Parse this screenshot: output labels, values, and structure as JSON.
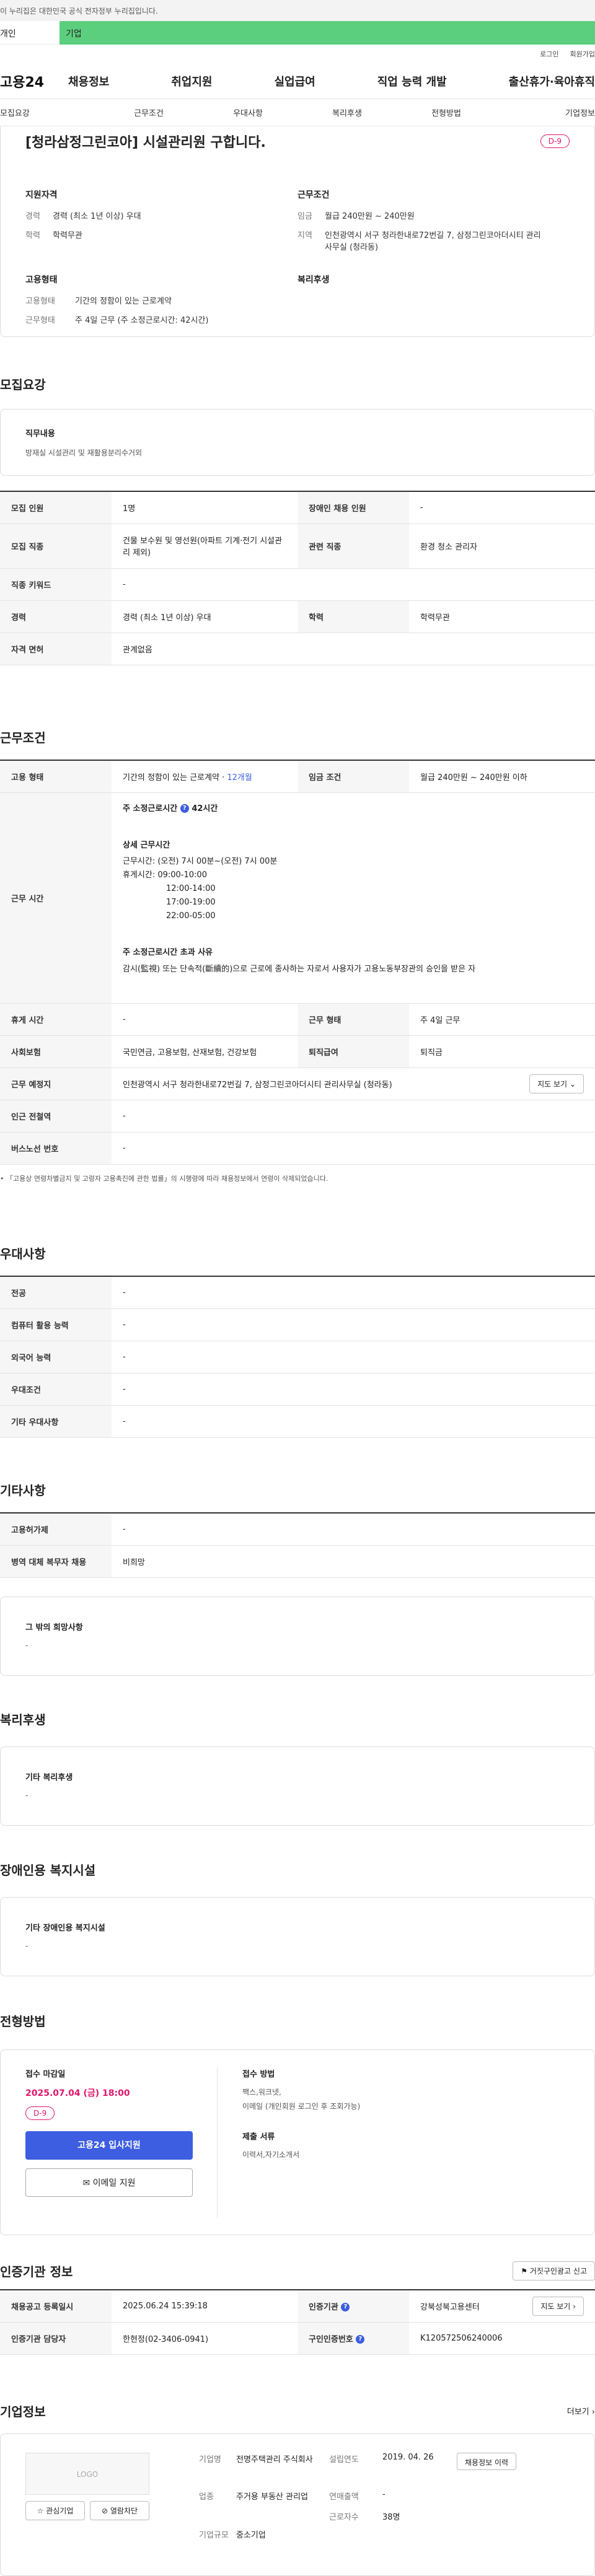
{
  "gov_banner": "이 누리집은 대한민국 공식 전자정부 누리집입니다.",
  "tabs": [
    "개인",
    "기업"
  ],
  "util": [
    "로그인",
    "회원가입"
  ],
  "logo": "고용24",
  "gnb": [
    "채용정보",
    "취업지원",
    "실업급여",
    "직업 능력 개발",
    "출산휴가·육아휴직"
  ],
  "subnav": [
    "모집요강",
    "근무조건",
    "우대사항",
    "복리후생",
    "전형방법",
    "기업정보"
  ],
  "summary": {
    "title": "[청라삼정그린코아] 시설관리원 구합니다.",
    "dday": "D-9",
    "qual_title": "지원자격",
    "qual": [
      {
        "k": "경력",
        "v": "경력 (최소 1년 이상) 우대"
      },
      {
        "k": "학력",
        "v": "학력무관"
      }
    ],
    "cond_title": "근무조건",
    "cond": [
      {
        "k": "임금",
        "v": "월급 240만원 ~ 240만원"
      },
      {
        "k": "지역",
        "v": "인천광역시 서구 청라한내로72번길 7, 삼정그린코아더시티 관리사무실 (청라동)"
      }
    ],
    "emp_title": "고용형태",
    "emp": [
      {
        "k": "고용형태",
        "v": "기간의 정함이 있는 근로계약"
      },
      {
        "k": "근무형태",
        "v": "주 4일 근무 (주 소정근로시간: 42시간)"
      }
    ],
    "welfare_title": "복리후생"
  },
  "recruit": {
    "title": "모집요강",
    "duty_label": "직무내용",
    "duty_text": "방재실 시설관리 및 재활용분리수거외",
    "rows": [
      {
        "k1": "모집 인원",
        "v1": "1명",
        "k2": "장애인 채용 인원",
        "v2": "-"
      },
      {
        "k1": "모집 직종",
        "v1": "건물 보수원 및 영선원(아파트 기계·전기 시설관리 제외)",
        "k2": "관련 직종",
        "v2": "환경 청소 관리자"
      },
      {
        "k1": "직종 키워드",
        "v1": "-",
        "k2": "",
        "v2": ""
      },
      {
        "k1": "경력",
        "v1": "경력 (최소 1년 이상) 우대",
        "k2": "학력",
        "v2": "학력무관"
      },
      {
        "k1": "자격 면허",
        "v1": "관계없음",
        "k2": "",
        "v2": ""
      }
    ]
  },
  "work": {
    "title": "근무조건",
    "emp_label": "고용 형태",
    "emp_value": "기간의 정함이 있는 근로계약 ·",
    "emp_link": "12개월",
    "wage_label": "임금 조건",
    "wage_value": "월급 240만원 ~ 240만원 이하",
    "time_label": "근무 시간",
    "weekly_label": "주 소정근로시간",
    "weekly_value": "42시간",
    "detail_title": "상세 근무시간",
    "detail_lines": [
      "근무시간: (오전) 7시 00분~(오전) 7시 00분",
      "휴게시간: 09:00-10:00",
      "12:00-14:00",
      "17:00-19:00",
      "22:00-05:00"
    ],
    "over_title": "주 소정근로시간 초과 사유",
    "over_text": "감시(監視) 또는 단속적(斷續的)으로 근로에 종사하는 자로서 사용자가 고용노동부장관의 승인을 받은 자",
    "break_label": "휴게 시간",
    "break_value": "-",
    "form_label": "근무 형태",
    "form_value": "주 4일 근무",
    "ins_label": "사회보험",
    "ins_value": "국민연금, 고용보험, 산재보험, 건강보험",
    "sev_label": "퇴직급여",
    "sev_value": "퇴직금",
    "place_label": "근무 예정지",
    "place_value": "인천광역시 서구 청라한내로72번길 7, 삼정그린코아더시티 관리사무실 (청라동)",
    "map_btn": "지도 보기",
    "subway_label": "인근 전철역",
    "subway_value": "-",
    "bus_label": "버스노선 번호",
    "bus_value": "-",
    "notice": "「고용상 연령차별금지 및 고령자 고용촉진에 관한 법률」의 시행령에 따라 채용정보에서 연령이 삭제되었습니다."
  },
  "pref": {
    "title": "우대사항",
    "rows": [
      {
        "k": "전공",
        "v": "-"
      },
      {
        "k": "컴퓨터 활용 능력",
        "v": "-"
      },
      {
        "k": "외국어 능력",
        "v": "-"
      },
      {
        "k": "우대조건",
        "v": "-"
      },
      {
        "k": "기타 우대사항",
        "v": "-"
      }
    ]
  },
  "etc": {
    "title": "기타사항",
    "rows": [
      {
        "k": "고용허가제",
        "v": "-"
      },
      {
        "k": "병역 대체 복무자 채용",
        "v": "비희망"
      }
    ],
    "other_label": "그 밖의 희망사항",
    "other_value": "-"
  },
  "welfare": {
    "title": "복리후생",
    "label": "기타 복리후생",
    "value": "-"
  },
  "disabled": {
    "title": "장애인용 복지시설",
    "label": "기타 장애인용 복지시설",
    "value": "-"
  },
  "process": {
    "title": "전형방법",
    "deadline_label": "접수 마감일",
    "deadline_value": "2025.07.04 (금) 18:00",
    "dday": "D-9",
    "apply_btn": "고용24 입사지원",
    "email_btn": "이메일 지원",
    "method_label": "접수 방법",
    "method_value1": "팩스,워크넷,",
    "method_value2": "이메일 (개인회원 로그인 후 조회가능)",
    "docs_label": "제출 서류",
    "docs_value": "이력서,자기소개서"
  },
  "cert": {
    "title": "인증기관 정보",
    "report_btn": "거짓구인광고 신고",
    "r1k1": "채용공고 등록일시",
    "r1v1": "2025.06.24 15:39:18",
    "r1k2": "인증기관",
    "r1v2": "강북성북고용센터",
    "map_btn": "지도 보기",
    "r2k1": "인증기관 담당자",
    "r2v1": "한현정(02-3406-0941)",
    "r2k2": "구인인증번호",
    "r2v2": "K120572506240006"
  },
  "company": {
    "title": "기업정보",
    "more": "더보기",
    "logo": "LOGO",
    "fav_btn": "관심기업",
    "block_btn": "열람차단",
    "name_label": "기업명",
    "name_value": "전명주택관리 주식회사",
    "year_label": "설립연도",
    "year_value": "2019. 04. 26",
    "info_btn": "채용정보 이력",
    "biz_label": "업종",
    "biz_value": "주거용 부동산 관리업",
    "sales_label": "연매출액",
    "sales_value": "-",
    "emp_label": "근로자수",
    "emp_value": "38명",
    "size_label": "기업규모",
    "size_value": "중소기업"
  }
}
